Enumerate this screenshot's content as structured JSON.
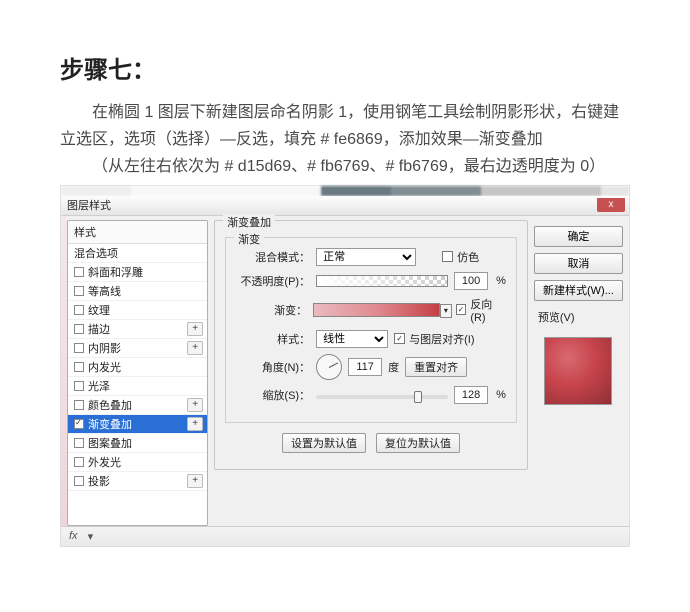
{
  "article": {
    "heading": "步骤七：",
    "p1": "在椭圆 1 图层下新建图层命名阴影 1，使用钢笔工具绘制阴影形状，右键建立选区，选项（选择）—反选，填充 # fe6869，添加效果—渐变叠加",
    "p2": "（从左往右依次为 # d15d69、# fb6769、# fb6769，最右边透明度为 0）"
  },
  "dialog": {
    "title": "图层样式",
    "close": "x",
    "styleListHeader": "样式",
    "items": [
      {
        "label": "混合选项",
        "checkbox": false,
        "plus": false
      },
      {
        "label": "斜面和浮雕",
        "checkbox": true,
        "plus": false
      },
      {
        "label": "等高线",
        "checkbox": true,
        "plus": false
      },
      {
        "label": "纹理",
        "checkbox": true,
        "plus": false
      },
      {
        "label": "描边",
        "checkbox": true,
        "plus": true
      },
      {
        "label": "内阴影",
        "checkbox": true,
        "plus": true
      },
      {
        "label": "内发光",
        "checkbox": true,
        "plus": false
      },
      {
        "label": "光泽",
        "checkbox": true,
        "plus": false
      },
      {
        "label": "颜色叠加",
        "checkbox": true,
        "plus": true
      },
      {
        "label": "渐变叠加",
        "checkbox": true,
        "plus": true,
        "selected": true,
        "checked": true
      },
      {
        "label": "图案叠加",
        "checkbox": true,
        "plus": false
      },
      {
        "label": "外发光",
        "checkbox": true,
        "plus": false
      },
      {
        "label": "投影",
        "checkbox": true,
        "plus": true
      }
    ],
    "group_title": "渐变叠加",
    "subgroup_title": "渐变",
    "labels": {
      "blend_mode": "混合模式：",
      "opacity": "不透明度(P)：",
      "gradient": "渐变：",
      "style": "样式：",
      "angle": "角度(N)：",
      "scale": "缩放(S)：",
      "degree_unit": "度",
      "reset_align": "重置对齐",
      "set_default": "设置为默认值",
      "reset_default": "复位为默认值",
      "dither": "仿色",
      "reverse": "反向(R)",
      "align_layer": "与图层对齐(I)"
    },
    "values": {
      "blend_mode": "正常",
      "opacity": "100",
      "style": "线性",
      "angle": "117",
      "scale": "128",
      "percent": "%"
    },
    "right": {
      "ok": "确定",
      "cancel": "取消",
      "new_style": "新建样式(W)...",
      "preview": "预览(V)"
    },
    "status": {
      "fx": "fx",
      "dot": "▾"
    }
  }
}
